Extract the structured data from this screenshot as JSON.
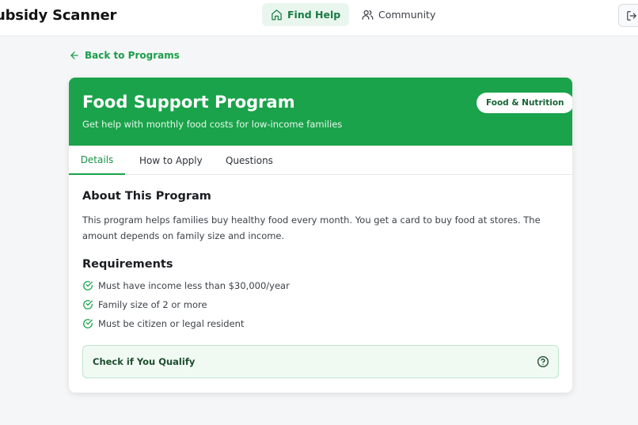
{
  "app": {
    "brand": "ubsidy Scanner"
  },
  "nav": {
    "find_help": "Find Help",
    "community": "Community"
  },
  "back_link": "Back to Programs",
  "program": {
    "title": "Food Support Program",
    "subtitle": "Get help with monthly food costs for low-income families",
    "category": "Food & Nutrition"
  },
  "tabs": [
    {
      "label": "Details",
      "active": true
    },
    {
      "label": "How to Apply",
      "active": false
    },
    {
      "label": "Questions",
      "active": false
    }
  ],
  "about": {
    "title": "About This Program",
    "text": "This program helps families buy healthy food every month. You get a card to buy food at stores. The amount depends on family size and income."
  },
  "requirements": {
    "title": "Requirements",
    "items": [
      "Must have income less than $30,000/year",
      "Family size of 2 or more",
      "Must be citizen or legal resident"
    ]
  },
  "qualify": {
    "label": "Check if You Qualify"
  },
  "colors": {
    "accent": "#1aa34a",
    "accent_soft": "#e9f6ee",
    "qualify_bg": "#f0faf3"
  },
  "icons": {
    "find_help": "home-icon",
    "community": "users-icon",
    "logout": "logout-icon",
    "back": "arrow-left-icon",
    "requirement": "check-circle-icon",
    "qualify": "help-circle-icon"
  }
}
